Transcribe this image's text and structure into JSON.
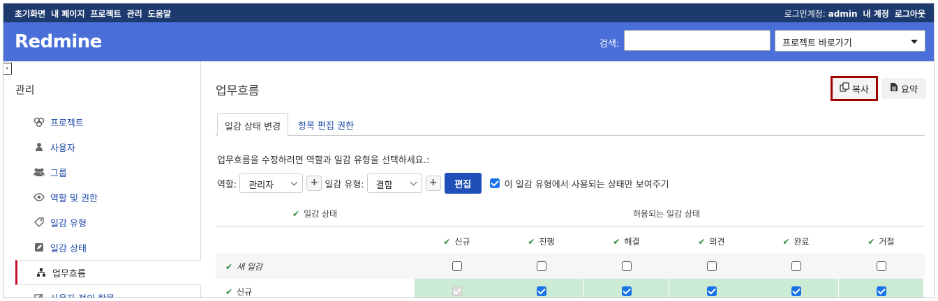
{
  "top_menu": {
    "items": [
      "초기화면",
      "내 페이지",
      "프로젝트",
      "관리",
      "도움말"
    ],
    "logged_as_label": "로그인계정:",
    "user": "admin",
    "my_account": "내 계정",
    "logout": "로그아웃"
  },
  "header": {
    "title": "Redmine",
    "search_label": "검색:",
    "search_value": "",
    "jump_to_project": "프로젝트 바로가기"
  },
  "sidebar": {
    "title": "관리",
    "items": [
      {
        "label": "프로젝트",
        "icon": "projects-icon"
      },
      {
        "label": "사용자",
        "icon": "user-icon"
      },
      {
        "label": "그룹",
        "icon": "group-icon"
      },
      {
        "label": "역할 및 권한",
        "icon": "eye-icon"
      },
      {
        "label": "일감 유형",
        "icon": "tag-icon"
      },
      {
        "label": "일감 상태",
        "icon": "edit-icon"
      },
      {
        "label": "업무흐름",
        "icon": "workflow-icon",
        "selected": true
      },
      {
        "label": "사용자 정의 항목",
        "icon": "custom-field-icon"
      }
    ]
  },
  "main": {
    "title": "업무흐름",
    "copy_button": "복사",
    "summary_button": "요약",
    "tabs": [
      "일감 상태 변경",
      "항목 편집 권한"
    ],
    "instruction": "업무흐름을 수정하려면 역할과 일감 유형을 선택하세요.:",
    "role_label": "역할:",
    "role_value": "관리자",
    "tracker_label": "일감 유형:",
    "tracker_value": "결함",
    "edit_button": "편집",
    "only_used_label": "이 일감 유형에서 사용되는 상태만 보여주기",
    "only_used_checked": true
  },
  "table": {
    "col_current": "일감 상태",
    "col_allowed": "허용되는 일감 상태",
    "statuses": [
      "신규",
      "진행",
      "해결",
      "의견",
      "완료",
      "거절"
    ],
    "rows": [
      {
        "label": "새 일감",
        "italic": true,
        "checks": [
          false,
          false,
          false,
          false,
          false,
          false
        ],
        "highlight": false
      },
      {
        "label": "신규",
        "italic": false,
        "checks": [
          "disabled",
          true,
          true,
          true,
          true,
          true
        ],
        "highlight": true
      }
    ]
  },
  "colors": {
    "top_menu_bg": "#1d3a6e",
    "header_bg": "#4a6fd9",
    "link": "#1e4aa8",
    "selected_border": "#c8102e",
    "highlight_row": "#ccebd4",
    "check_green": "#2a8a3a",
    "copy_button_outline": "#a00000"
  }
}
